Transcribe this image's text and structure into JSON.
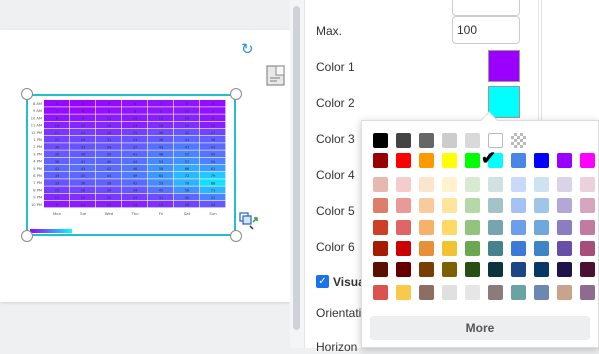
{
  "properties": {
    "max_label": "Max.",
    "max_value": "100",
    "color1_label": "Color 1",
    "color1_value": "#9b00ff",
    "color2_label": "Color 2",
    "color2_value": "#00ffff",
    "color3_label": "Color 3",
    "color4_label": "Color 4",
    "color5_label": "Color 5",
    "color6_label": "Color 6",
    "visual_label": "Visua",
    "orientation_label": "Orientati",
    "horizontal_label": "Horizon"
  },
  "color_picker": {
    "selected": "#000000",
    "more_label": "More",
    "rows": [
      [
        "#000000",
        "#444444",
        "#666666",
        "#cccccc",
        "#d9d9d9",
        "#ffffff",
        "transparent"
      ],
      [
        "#990000",
        "#ff0000",
        "#ff9900",
        "#ffff00",
        "#00ff00",
        "#00ffff",
        "#4a86e8",
        "#0000ff",
        "#9900ff",
        "#ff00ff"
      ],
      [
        "#e6b8af",
        "#f4cccc",
        "#fce5cd",
        "#fff2cc",
        "#d9ead3",
        "#d0e0e3",
        "#c9daf8",
        "#cfe2f3",
        "#d9d2e9",
        "#ead1dc"
      ],
      [
        "#dd7e6b",
        "#ea9999",
        "#f9cb9c",
        "#ffe599",
        "#b6d7a8",
        "#a2c4c9",
        "#a4c2f4",
        "#9fc5e8",
        "#b4a7d6",
        "#d5a6bd"
      ],
      [
        "#cc4125",
        "#e06666",
        "#f6b26b",
        "#ffd966",
        "#93c47d",
        "#76a5af",
        "#6d9eeb",
        "#6fa8dc",
        "#8e7cc3",
        "#c27ba0"
      ],
      [
        "#a61c00",
        "#cc0000",
        "#e69138",
        "#f1c232",
        "#6aa84f",
        "#45818e",
        "#3c78d8",
        "#3d85c6",
        "#674ea7",
        "#a64d79"
      ],
      [
        "#5b0f00",
        "#660000",
        "#783f04",
        "#7f6000",
        "#274e13",
        "#0c343d",
        "#1c4587",
        "#073763",
        "#20124d",
        "#4c1130"
      ],
      [
        "#d9534f",
        "#f8c94a",
        "#8d6e63",
        "#e0e0e0",
        "#e6e6e6",
        "#8c7b7b",
        "#6aa3a3",
        "#6c88b0",
        "#c9a38d",
        "#8f6b8f"
      ]
    ]
  },
  "heatmap": {
    "row_labels": [
      "8 AM",
      "9 AM",
      "10 AM",
      "11 AM",
      "12 PM",
      "1 PM",
      "2 PM",
      "3 PM",
      "4 PM",
      "5 PM",
      "6 PM",
      "7 PM",
      "8 PM",
      "9 PM",
      "10 PM"
    ],
    "col_labels": [
      "Mon",
      "Tue",
      "Wed",
      "Thu",
      "Fri",
      "Sat",
      "Sun"
    ],
    "values": [
      [
        3,
        2,
        4,
        6,
        7,
        8,
        5
      ],
      [
        5,
        4,
        6,
        8,
        9,
        10,
        7
      ],
      [
        8,
        9,
        11,
        10,
        12,
        14,
        9
      ],
      [
        14,
        15,
        16,
        13,
        18,
        19,
        12
      ],
      [
        21,
        24,
        20,
        25,
        30,
        32,
        27
      ],
      [
        27,
        29,
        31,
        33,
        36,
        41,
        38
      ],
      [
        30,
        33,
        34,
        37,
        43,
        47,
        41
      ],
      [
        35,
        36,
        39,
        41,
        48,
        52,
        45
      ],
      [
        38,
        41,
        40,
        44,
        53,
        57,
        50
      ],
      [
        41,
        43,
        42,
        46,
        58,
        66,
        61
      ],
      [
        39,
        40,
        44,
        49,
        60,
        72,
        79
      ],
      [
        33,
        36,
        38,
        42,
        55,
        70,
        88
      ],
      [
        25,
        28,
        30,
        34,
        45,
        58,
        71
      ],
      [
        17,
        19,
        22,
        24,
        31,
        40,
        52
      ],
      [
        9,
        11,
        12,
        14,
        19,
        26,
        34
      ]
    ],
    "min": 0,
    "max": 100,
    "color_low": "#9b00ff",
    "color_high": "#00ffff"
  }
}
